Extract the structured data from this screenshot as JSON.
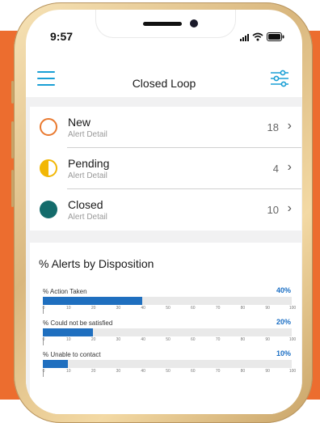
{
  "status_bar": {
    "time": "9:57"
  },
  "nav": {
    "title": "Closed Loop"
  },
  "statuses": [
    {
      "title": "New",
      "subtitle": "Alert Detail",
      "count": "18",
      "color": "#e9792f",
      "style": "ring"
    },
    {
      "title": "Pending",
      "subtitle": "Alert Detail",
      "count": "4",
      "color": "#f2b705",
      "style": "half"
    },
    {
      "title": "Closed",
      "subtitle": "Alert Detail",
      "count": "10",
      "color": "#136b6b",
      "style": "solid"
    }
  ],
  "chart": {
    "title": "% Alerts by Disposition",
    "ticks": [
      "0",
      "10",
      "20",
      "30",
      "40",
      "50",
      "60",
      "70",
      "80",
      "90",
      "100"
    ]
  },
  "chart_data": {
    "type": "bar",
    "orientation": "horizontal",
    "categories": [
      "% Action Taken",
      "% Could not be satisfied",
      "% Unable to contact"
    ],
    "values": [
      40,
      20,
      10
    ],
    "value_labels": [
      "40%",
      "20%",
      "10%"
    ],
    "xlim": [
      0,
      100
    ],
    "title": "% Alerts by Disposition",
    "bar_color": "#1f6fbf",
    "track_color": "#e9e9e9",
    "grid": false
  },
  "colors": {
    "accent": "#1a9fd5",
    "background_orange": "#ec6d2f",
    "percent_text": "#1a6ec4"
  }
}
